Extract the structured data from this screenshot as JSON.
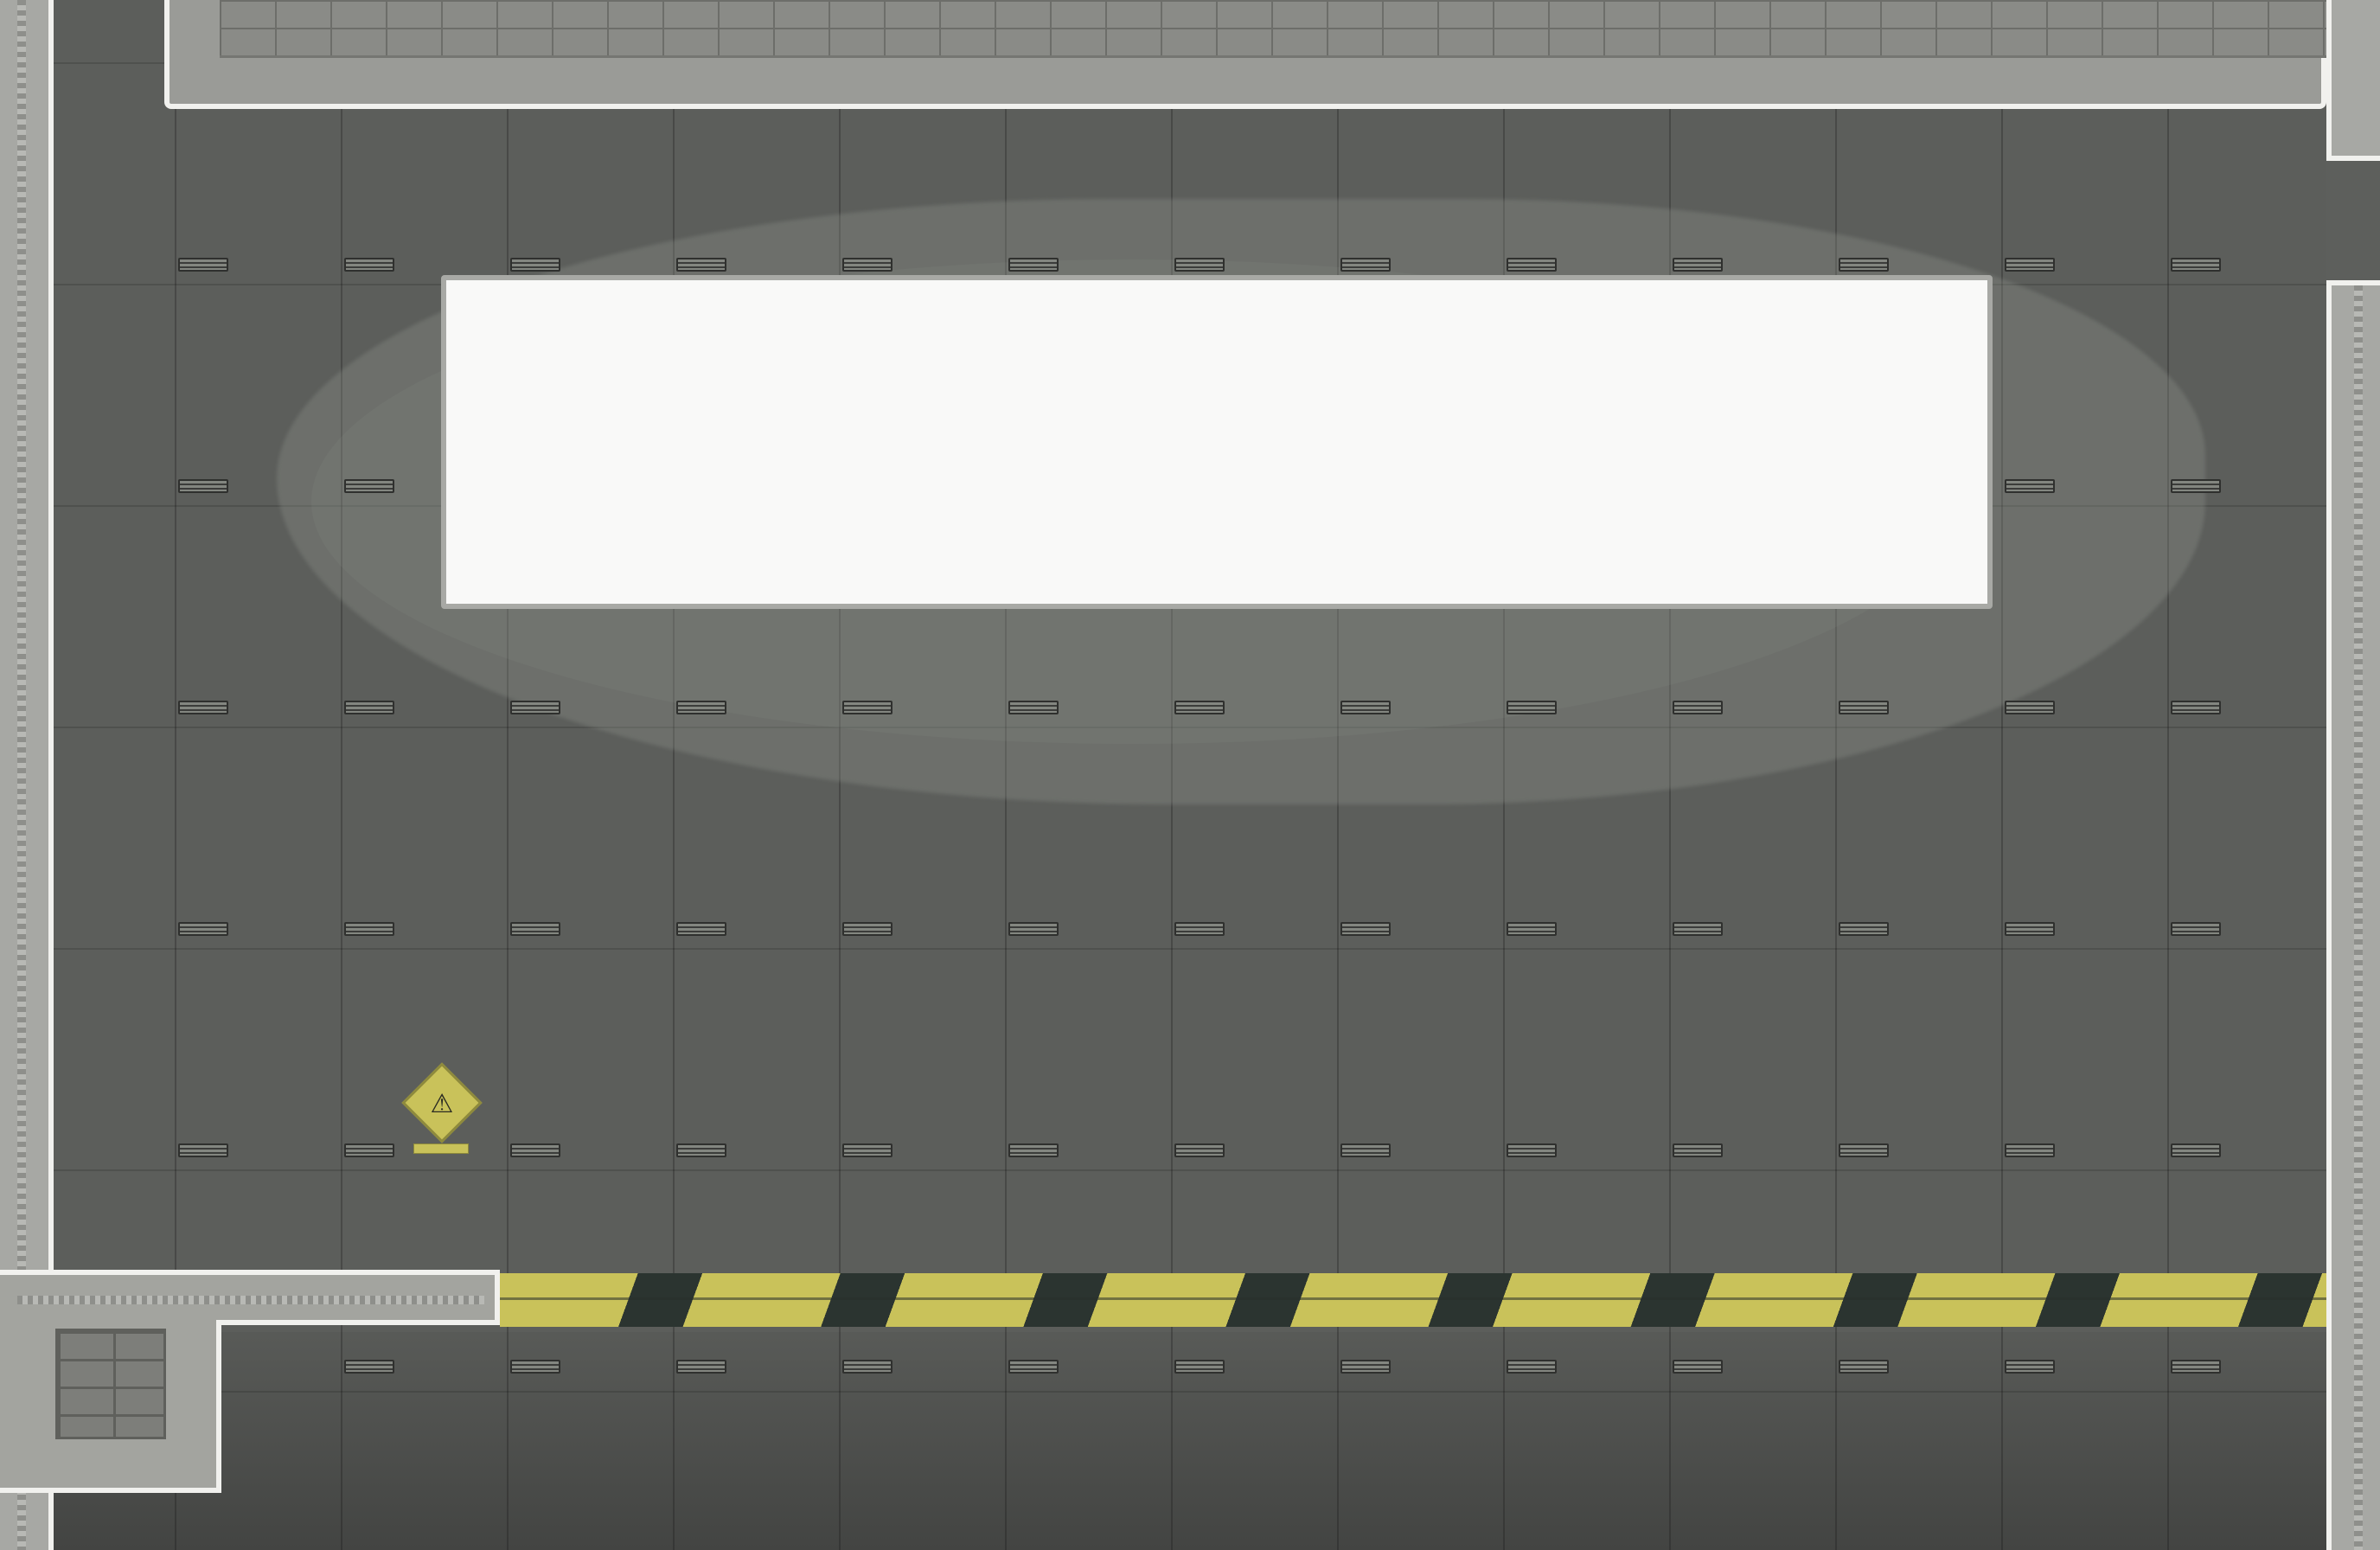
{
  "scene": {
    "type": "top-down game level",
    "floor_color": "#5c5e5b",
    "wall_color": "#a7a8a4",
    "wall_edge_color": "#f1f1ee",
    "hazard_colors": [
      "#c9c25a",
      "#2b3430"
    ]
  },
  "panel": {
    "text": ""
  },
  "warning_sign": {
    "icon": "hazard-diamond-icon",
    "color": "#c9c25a"
  }
}
